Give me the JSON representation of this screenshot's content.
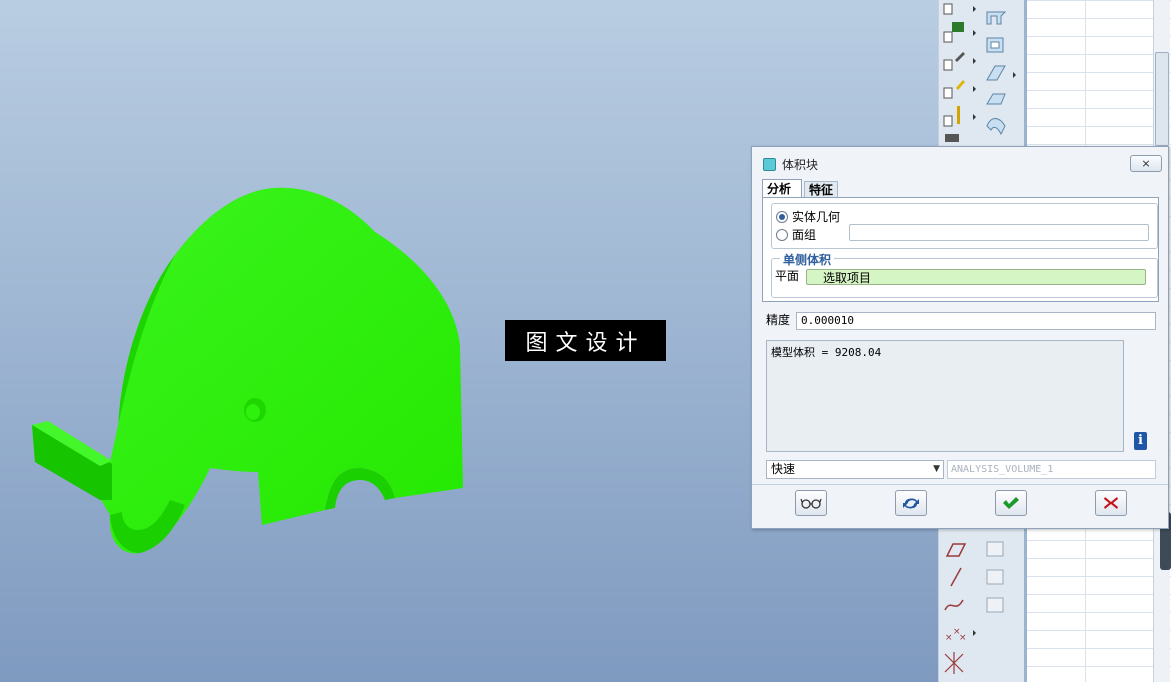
{
  "watermark": {
    "text": "图文设计"
  },
  "dialog": {
    "title": "体积块",
    "close_label": "⨯",
    "tabs": [
      {
        "label": "分析"
      },
      {
        "label": "特征"
      }
    ],
    "geometry_options": [
      {
        "label": "实体几何",
        "checked": true
      },
      {
        "label": "面组",
        "checked": false
      }
    ],
    "one_side_volume": {
      "legend": "单侧体积",
      "plane_label": "平面",
      "selector_text": "选取项目"
    },
    "precision": {
      "label": "精度",
      "value": "0.000010"
    },
    "result_text": "模型体积 = 9208.04",
    "mode_select": {
      "value": "快速"
    },
    "analysis_name": "ANALYSIS_VOLUME_1",
    "buttons": {
      "preview": "glasses-icon",
      "repeat": "repeat-icon",
      "ok": "checkmark-icon",
      "cancel": "close-icon"
    }
  },
  "colors": {
    "model": "#22ee00",
    "ok_green": "#1a9a2a",
    "cancel_red": "#c0141a",
    "accent_blue": "#2f5f9c"
  }
}
